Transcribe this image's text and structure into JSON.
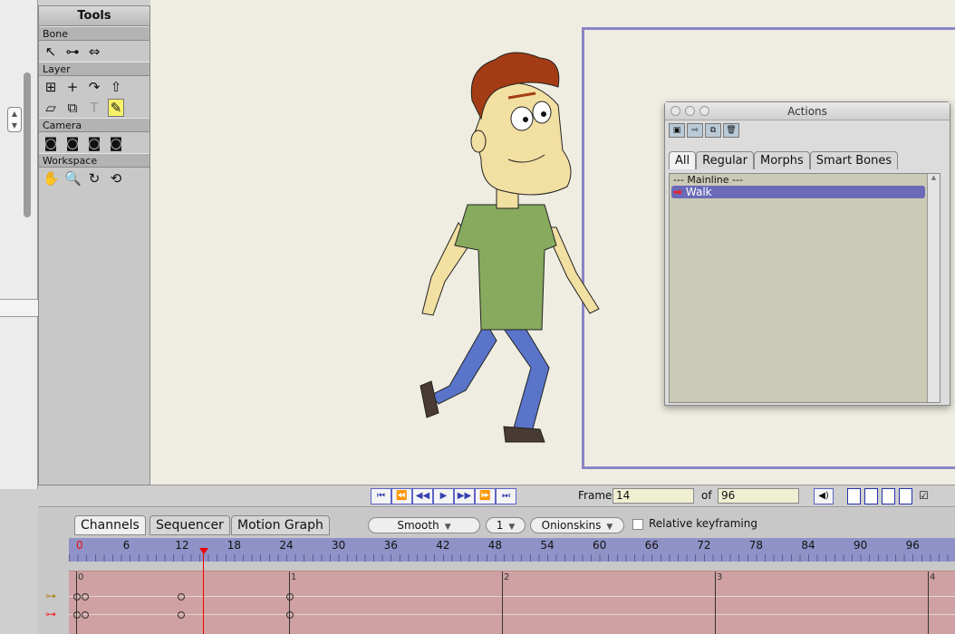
{
  "tools": {
    "title": "Tools",
    "sections": [
      "Bone",
      "Layer",
      "Camera",
      "Workspace"
    ]
  },
  "actions": {
    "title": "Actions",
    "tabs": [
      "All",
      "Regular",
      "Morphs",
      "Smart Bones"
    ],
    "items": [
      "--- Mainline ---",
      "Walk"
    ]
  },
  "playback": {
    "frame_label": "Frame",
    "frame_value": "14",
    "of_label": "of",
    "total_frames": "96"
  },
  "timeline": {
    "tabs": [
      "Channels",
      "Sequencer",
      "Motion Graph"
    ],
    "interpolation": "Smooth",
    "onion_count": "1",
    "onionskins": "Onionskins",
    "relative_keyframing": "Relative keyframing",
    "ruler_ticks": [
      "0",
      "6",
      "12",
      "18",
      "24",
      "30",
      "36",
      "42",
      "48",
      "54",
      "60",
      "66",
      "72",
      "78",
      "84",
      "90",
      "96"
    ],
    "second_marks": [
      "0",
      "1",
      "2",
      "3",
      "4"
    ]
  },
  "colors": {
    "canvas": "#efede1",
    "camera_frame": "#8b84c6",
    "ruler": "#8f92c7",
    "track": "#cfa1a2",
    "selection": "#6a6ab9",
    "playhead": "#ee0000"
  }
}
